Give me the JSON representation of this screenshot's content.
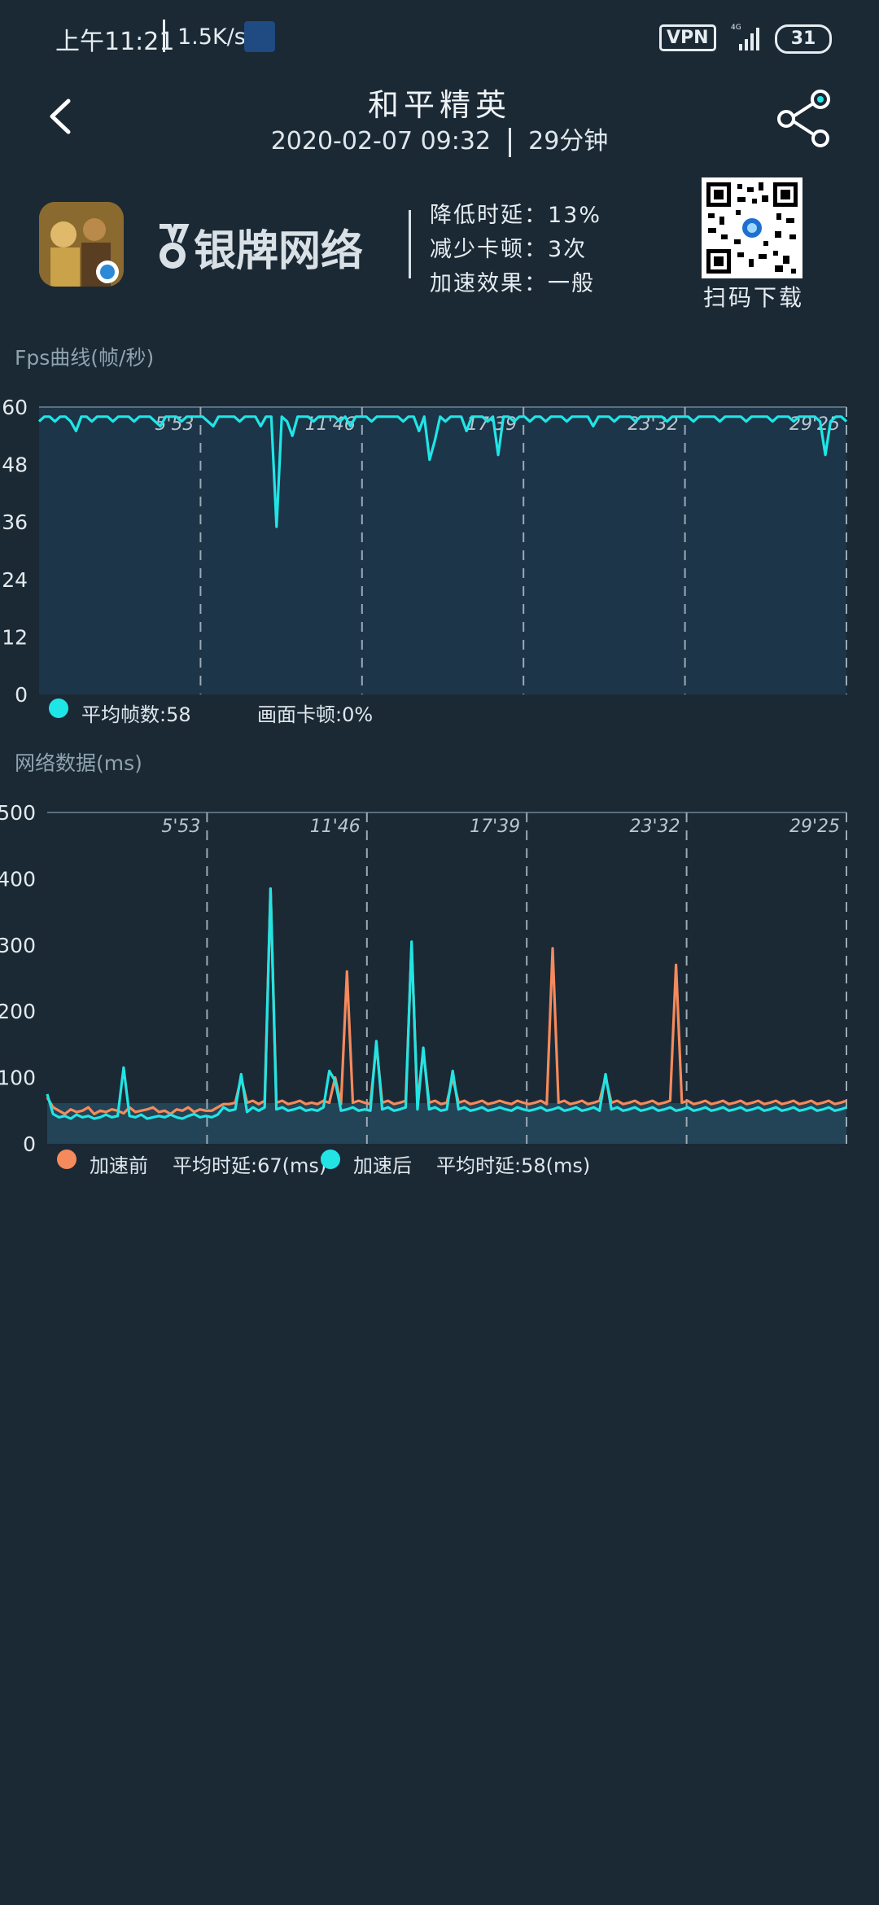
{
  "status_bar": {
    "time": "上午11:21",
    "speed": "1.5K/s",
    "vpn": "VPN",
    "network": "4G",
    "battery": "31"
  },
  "header": {
    "title": "和平精英",
    "datetime": "2020-02-07 09:32",
    "duration": "29分钟"
  },
  "banner": {
    "brand": "银牌网络",
    "stats": [
      "降低时延：13%",
      "减少卡顿：3次",
      "加速效果：一般"
    ],
    "qr_caption": "扫码下载"
  },
  "fps_section": {
    "title": "Fps曲线(帧/秒)",
    "legend_avg": "平均帧数:58",
    "legend_stutter": "画面卡顿:0%"
  },
  "net_section": {
    "title": "网络数据(ms)",
    "legend_before_label": "加速前",
    "legend_before_avg": "平均时延:67(ms)",
    "legend_after_label": "加速后",
    "legend_after_avg": "平均时延:58(ms)"
  },
  "colors": {
    "background": "#1b2935",
    "plot_fill": "#1d3548",
    "series_fps": "#1fe6e6",
    "series_before": "#f58a5c",
    "series_after": "#22e4e4"
  },
  "chart_data": [
    {
      "type": "line",
      "title": "Fps曲线(帧/秒)",
      "ylim": [
        0,
        60
      ],
      "yticks": [
        0,
        12,
        24,
        36,
        48,
        60
      ],
      "x_markers": [
        "5'53",
        "11'46",
        "17'39",
        "23'32",
        "29'25"
      ],
      "series": [
        {
          "values": [
            57,
            58,
            58,
            57,
            58,
            58,
            57,
            55,
            58,
            58,
            57,
            58,
            58,
            58,
            57,
            58,
            58,
            58,
            57,
            58,
            58,
            58,
            57,
            56,
            58,
            58,
            58,
            57,
            58,
            58,
            58,
            58,
            57,
            56,
            58,
            58,
            58,
            58,
            57,
            58,
            58,
            58,
            56,
            58,
            58,
            35,
            58,
            57,
            54,
            58,
            58,
            58,
            57,
            58,
            58,
            58,
            58,
            57,
            58,
            56,
            58,
            58,
            58,
            57,
            58,
            58,
            58,
            58,
            58,
            57,
            58,
            58,
            55,
            58,
            49,
            53,
            58,
            57,
            58,
            58,
            58,
            55,
            58,
            58,
            58,
            57,
            58,
            50,
            58,
            58,
            57,
            58,
            58,
            57,
            58,
            58,
            57,
            58,
            58,
            58,
            57,
            58,
            58,
            58,
            58,
            56,
            58,
            58,
            58,
            57,
            58,
            58,
            58,
            57,
            58,
            58,
            58,
            58,
            58,
            57,
            58,
            58,
            58,
            58,
            57,
            58,
            58,
            58,
            58,
            57,
            58,
            58,
            58,
            58,
            57,
            58,
            58,
            58,
            58,
            57,
            58,
            58,
            58,
            57,
            58,
            58,
            58,
            58,
            57,
            50,
            57,
            58,
            58,
            57
          ]
        }
      ],
      "legend": [
        "平均帧数:58",
        "画面卡顿:0%"
      ]
    },
    {
      "type": "line",
      "title": "网络数据(ms)",
      "ylim": [
        0,
        500
      ],
      "yticks": [
        0,
        100,
        200,
        300,
        400,
        500
      ],
      "x_markers": [
        "5'53",
        "11'46",
        "17'39",
        "23'32",
        "29'25"
      ],
      "series": [
        {
          "name": "加速前",
          "values": [
            70,
            55,
            50,
            45,
            52,
            48,
            50,
            55,
            45,
            50,
            48,
            52,
            50,
            46,
            55,
            48,
            50,
            52,
            55,
            48,
            50,
            45,
            52,
            50,
            55,
            48,
            52,
            50,
            50,
            55,
            60,
            60,
            62,
            100,
            62,
            65,
            60,
            65,
            385,
            62,
            65,
            60,
            62,
            65,
            60,
            62,
            60,
            65,
            62,
            100,
            60,
            260,
            62,
            65,
            62,
            60,
            150,
            62,
            65,
            60,
            62,
            65,
            300,
            62,
            140,
            62,
            65,
            60,
            62,
            100,
            62,
            65,
            60,
            62,
            65,
            60,
            62,
            65,
            62,
            60,
            65,
            62,
            60,
            62,
            65,
            60,
            295,
            62,
            65,
            60,
            62,
            65,
            60,
            62,
            65,
            100,
            62,
            65,
            60,
            62,
            65,
            60,
            62,
            65,
            60,
            62,
            65,
            270,
            62,
            65,
            60,
            62,
            65,
            60,
            62,
            65,
            60,
            62,
            65,
            60,
            62,
            65,
            60,
            62,
            65,
            60,
            62,
            65,
            60,
            62,
            65,
            60,
            62,
            65,
            60,
            62,
            65
          ]
        },
        {
          "name": "加速后",
          "values": [
            75,
            45,
            40,
            42,
            38,
            44,
            40,
            42,
            38,
            40,
            44,
            40,
            42,
            115,
            42,
            40,
            44,
            38,
            40,
            42,
            40,
            44,
            40,
            38,
            42,
            45,
            40,
            42,
            40,
            44,
            55,
            50,
            52,
            105,
            48,
            55,
            50,
            55,
            385,
            52,
            55,
            50,
            52,
            55,
            50,
            52,
            50,
            55,
            110,
            95,
            50,
            52,
            55,
            50,
            52,
            50,
            155,
            52,
            55,
            50,
            52,
            55,
            305,
            52,
            145,
            52,
            55,
            50,
            52,
            110,
            52,
            55,
            50,
            52,
            55,
            50,
            52,
            55,
            52,
            50,
            55,
            52,
            50,
            52,
            55,
            50,
            52,
            55,
            50,
            52,
            55,
            50,
            52,
            55,
            50,
            105,
            52,
            55,
            50,
            52,
            55,
            50,
            52,
            55,
            50,
            52,
            55,
            50,
            52,
            55,
            50,
            52,
            55,
            50,
            52,
            55,
            50,
            52,
            55,
            50,
            52,
            55,
            50,
            52,
            55,
            50,
            52,
            55,
            50,
            52,
            55,
            50,
            52,
            55,
            50,
            52,
            55
          ]
        }
      ],
      "legend": [
        "加速前 平均时延:67(ms)",
        "加速后 平均时延:58(ms)"
      ]
    }
  ]
}
